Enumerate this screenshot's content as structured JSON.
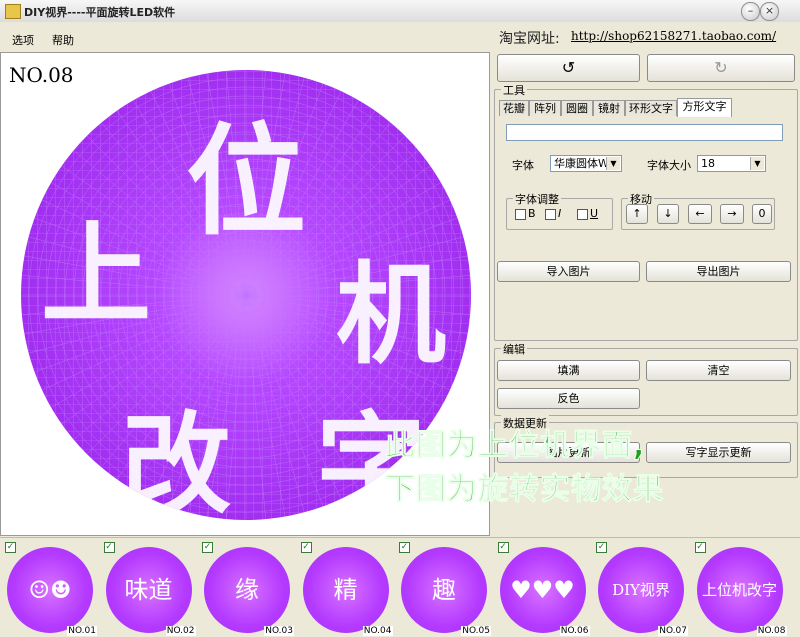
{
  "window": {
    "title": "DIY视界----平面旋转LED软件"
  },
  "menu": {
    "items": [
      "选项",
      "帮助"
    ],
    "shop_label": "淘宝网址:",
    "shop_url": "http://shop62158271.taobao.com/"
  },
  "canvas": {
    "frame_label": "NO.08",
    "characters": [
      "上",
      "位",
      "机",
      "改",
      "字"
    ],
    "disc_color": "#a52ef5",
    "lit_color": "#ffffff"
  },
  "toolbar": {
    "rotate_left": "↺",
    "rotate_right": "↻"
  },
  "tools": {
    "group_label": "工具",
    "tabs": [
      "花瓣",
      "阵列",
      "圆圈",
      "镜射",
      "环形文字",
      "方形文字"
    ],
    "active_tab": "方形文字",
    "text_value": "",
    "font_label": "字体",
    "font_value": "华康圆体W9",
    "font_size_label": "字体大小",
    "font_size_value": "18",
    "adjust_label": "字体调整",
    "adjust_options": [
      "B",
      "I",
      "U"
    ],
    "move_label": "移动",
    "move_buttons": [
      "↑",
      "↓",
      "←",
      "→",
      "0"
    ],
    "import_button": "导入图片",
    "export_button": "导出图片"
  },
  "edit": {
    "group_label": "编辑",
    "fill_button": "填满",
    "clear_button": "清空",
    "invert_button": "反色"
  },
  "update": {
    "group_label": "数据更新",
    "picture_update": "图片更新",
    "text_update": "写字显示更新"
  },
  "overlay": {
    "line1": "此图为上位机界面,",
    "line2": "下图为旋转实物效果"
  },
  "thumbnails": [
    {
      "label": "NO.01",
      "text": "☺☻",
      "checked": true
    },
    {
      "label": "NO.02",
      "text": "味道",
      "checked": true
    },
    {
      "label": "NO.03",
      "text": "缘",
      "checked": true
    },
    {
      "label": "NO.04",
      "text": "精",
      "checked": true
    },
    {
      "label": "NO.05",
      "text": "趣",
      "checked": true
    },
    {
      "label": "NO.06",
      "text": "♥♥♥",
      "checked": true
    },
    {
      "label": "NO.07",
      "text": "DIY视界",
      "checked": true
    },
    {
      "label": "NO.08",
      "text": "上位机改字",
      "checked": true
    }
  ]
}
